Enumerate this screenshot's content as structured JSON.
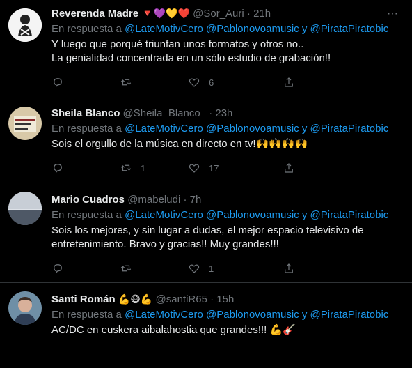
{
  "tweets": [
    {
      "name": "Reverenda Madre",
      "name_emoji": "🔻💜💛❤️",
      "handle": "@Sor_Auri",
      "time": "21h",
      "reply_prefix": "En respuesta a",
      "mentions": [
        "@LateMotivCero",
        "@Pablonovoamusic",
        "y",
        "@PirataPiratobic"
      ],
      "text_lines": [
        "Y luego que porqué triunfan unos formatos y otros no..",
        "La genialidad concentrada en un sólo estudio de grabación!!"
      ],
      "retweets": "",
      "likes": "6"
    },
    {
      "name": "Sheila Blanco",
      "name_emoji": "",
      "handle": "@Sheila_Blanco_",
      "time": "23h",
      "reply_prefix": "En respuesta a",
      "mentions": [
        "@LateMotivCero",
        "@Pablonovoamusic",
        "y",
        "@PirataPiratobic"
      ],
      "text_lines": [
        "Sois el orgullo de la música en directo en tv!🙌🙌🙌🙌"
      ],
      "retweets": "1",
      "likes": "17"
    },
    {
      "name": "Mario Cuadros",
      "name_emoji": "",
      "handle": "@mabeludi",
      "time": "7h",
      "reply_prefix": "En respuesta a",
      "mentions": [
        "@LateMotivCero",
        "@Pablonovoamusic",
        "y",
        "@PirataPiratobic"
      ],
      "text_lines": [
        "Sois los mejores, y sin lugar a dudas, el mejor espacio televisivo de",
        "entretenimiento. Bravo y gracias!! Muy grandes!!!"
      ],
      "retweets": "",
      "likes": "1"
    },
    {
      "name": "Santi Román",
      "name_emoji": "💪😷💪",
      "handle": "@santiR65",
      "time": "15h",
      "reply_prefix": "En respuesta a",
      "mentions": [
        "@LateMotivCero",
        "@Pablonovoamusic",
        "y",
        "@PirataPiratobic"
      ],
      "text_lines": [
        "AC/DC en euskera aibalahostia que grandes!!! 💪🎸"
      ],
      "retweets": "",
      "likes": ""
    }
  ],
  "icons": [
    "reply-icon",
    "retweet-icon",
    "like-icon",
    "share-icon",
    "more-icon"
  ],
  "colors": {
    "background": "#000000",
    "text": "#e7e9ea",
    "muted": "#71767b",
    "link": "#1d9bf0",
    "divider": "#2f3336"
  }
}
